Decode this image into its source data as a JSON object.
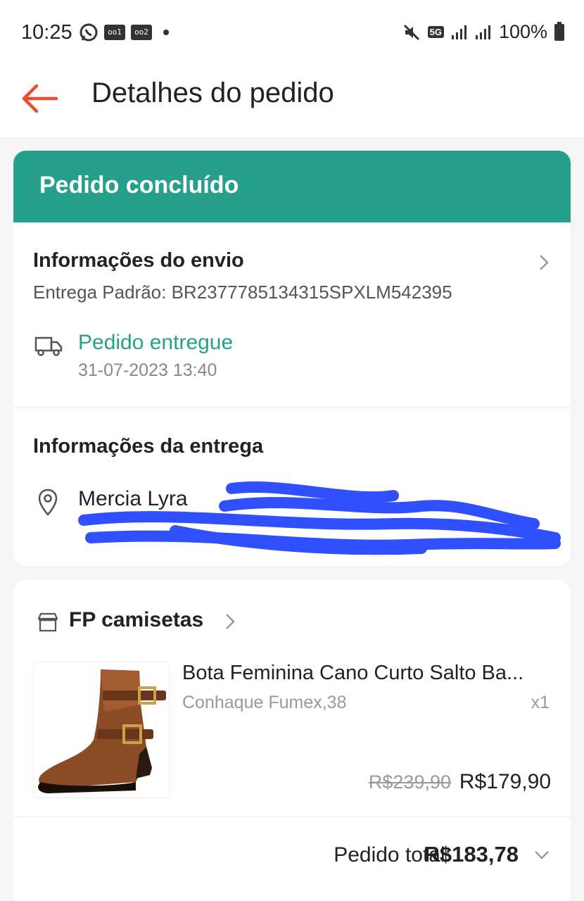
{
  "statusbar": {
    "time": "10:25",
    "icons": [
      "whatsapp-icon",
      "voicemail-icon",
      "voicemail-icon",
      "notification-dot"
    ],
    "voicemail1": "oo1",
    "voicemail2": "oo2",
    "network": "5G",
    "battery": "100%"
  },
  "header": {
    "title": "Detalhes do pedido",
    "back_icon": "arrow-left-icon"
  },
  "order_status": {
    "label": "Pedido concluído",
    "color": "#26a08b"
  },
  "shipping": {
    "title": "Informações do envio",
    "tracking": "Entrega Padrão: BR2377785134315SPXLM542395",
    "status": "Pedido entregue",
    "date": "31-07-2023 13:40"
  },
  "delivery": {
    "title": "Informações da entrega",
    "recipient": "Mercia Lyra",
    "redacted": true
  },
  "shop": {
    "name": "FP camisetas"
  },
  "product": {
    "name": "Bota Feminina Cano Curto Salto Ba...",
    "variant": "Conhaque Fumex,38",
    "quantity": "x1",
    "price_original": "R$239,90",
    "price": "R$179,90"
  },
  "total": {
    "label": "Pedido total:",
    "value": "R$183,78"
  },
  "colors": {
    "accent_orange": "#ee4d2d",
    "success_green": "#26a08b",
    "redaction_blue": "#1a3cff"
  }
}
